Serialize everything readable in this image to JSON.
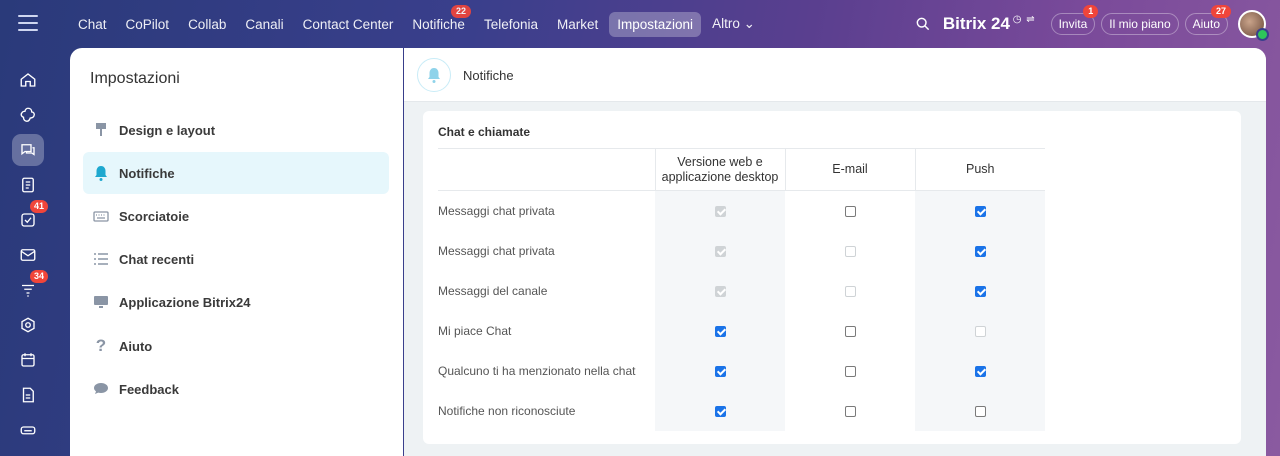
{
  "topnav": {
    "items": [
      {
        "label": "Chat"
      },
      {
        "label": "CoPilot"
      },
      {
        "label": "Collab"
      },
      {
        "label": "Canali"
      },
      {
        "label": "Contact Center"
      },
      {
        "label": "Notifiche",
        "badge": "22"
      },
      {
        "label": "Telefonia"
      },
      {
        "label": "Market"
      },
      {
        "label": "Impostazioni",
        "active": true
      },
      {
        "label": "Altro ⌄"
      }
    ],
    "brand": "Bitrix 24",
    "invite_label": "Invita",
    "invite_badge": "1",
    "plan_label": "Il mio piano",
    "help_label": "Aiuto",
    "help_badge": "27"
  },
  "rail": {
    "badges": {
      "tasks": "41",
      "feed": "34"
    }
  },
  "settings": {
    "title": "Impostazioni",
    "menu": [
      {
        "label": "Design e layout",
        "icon": "brush-icon"
      },
      {
        "label": "Notifiche",
        "icon": "bell-icon",
        "active": true
      },
      {
        "label": "Scorciatoie",
        "icon": "keyboard-icon"
      },
      {
        "label": "Chat recenti",
        "icon": "list-icon"
      },
      {
        "label": "Applicazione Bitrix24",
        "icon": "monitor-icon"
      },
      {
        "label": "Aiuto",
        "icon": "question-icon"
      },
      {
        "label": "Feedback",
        "icon": "chat-bubble-icon"
      }
    ]
  },
  "content": {
    "header_title": "Notifiche",
    "section_title": "Chat e chiamate",
    "columns": [
      "Versione web e applicazione desktop",
      "E-mail",
      "Push"
    ],
    "rows": [
      {
        "label": "Messaggi chat privata",
        "web": "dis-on",
        "email": "off",
        "push": "on"
      },
      {
        "label": "Messaggi chat privata",
        "web": "dis-on",
        "email": "dis",
        "push": "on"
      },
      {
        "label": "Messaggi del canale",
        "web": "dis-on",
        "email": "dis",
        "push": "on"
      },
      {
        "label": "Mi piace Chat",
        "web": "on",
        "email": "off",
        "push": "dis"
      },
      {
        "label": "Qualcuno ti ha menzionato nella chat",
        "web": "on",
        "email": "off",
        "push": "on"
      },
      {
        "label": "Notifiche non riconosciute",
        "web": "on",
        "email": "off",
        "push": "off"
      }
    ]
  }
}
